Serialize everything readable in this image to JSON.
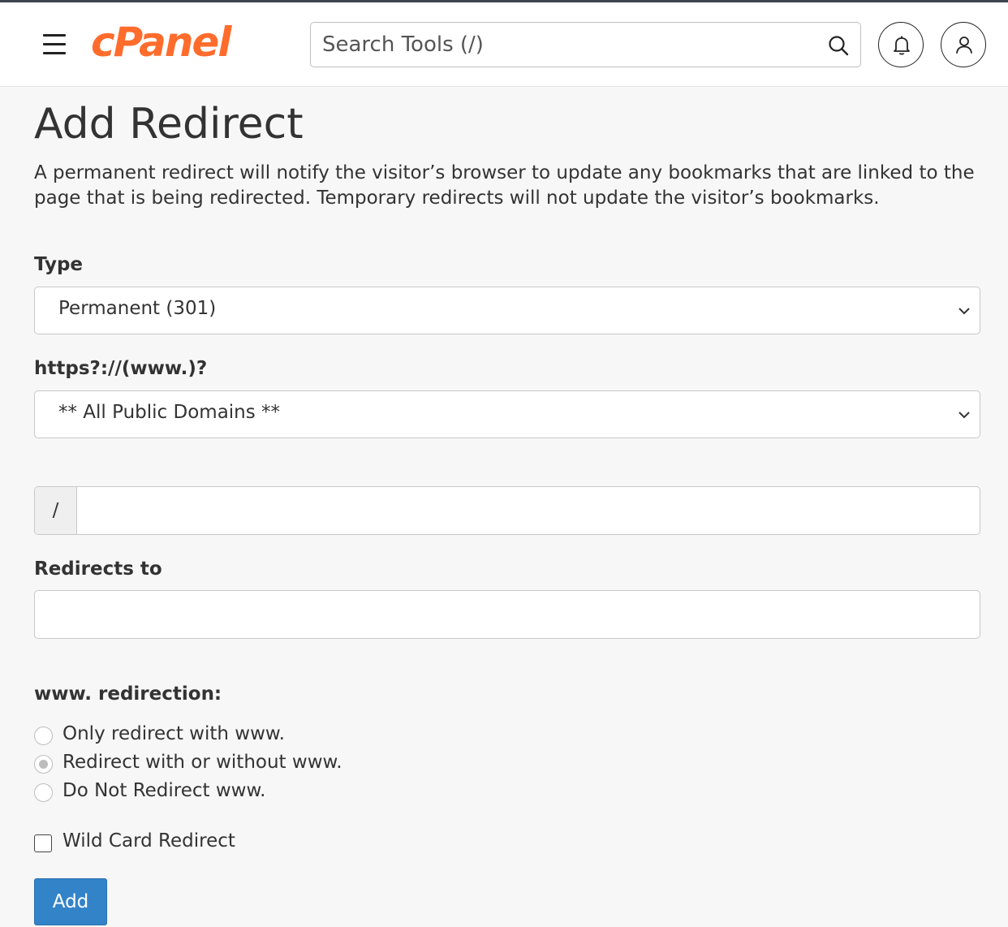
{
  "header": {
    "logo_text": "cPanel",
    "brand_color": "#ff6c2c",
    "search_placeholder": "Search Tools (/)",
    "icons": [
      "menu-icon",
      "search-icon",
      "bell-icon",
      "user-icon"
    ]
  },
  "page": {
    "title": "Add Redirect",
    "description": "A permanent redirect will notify the visitor’s browser to update any bookmarks that are linked to the page that is being redirected. Temporary redirects will not update the visitor’s bookmarks."
  },
  "form": {
    "type_label": "Type",
    "type_value": "Permanent (301)",
    "domain_label": "https?://(www.)?",
    "domain_value": "** All Public Domains **",
    "path_prefix": "/",
    "path_value": "",
    "redirects_to_label": "Redirects to",
    "redirects_to_value": "",
    "www_label": "www. redirection:",
    "www_options": [
      {
        "label": "Only redirect with www.",
        "checked": false
      },
      {
        "label": "Redirect with or without www.",
        "checked": true
      },
      {
        "label": "Do Not Redirect www.",
        "checked": false
      }
    ],
    "wildcard_label": "Wild Card Redirect",
    "wildcard_checked": false,
    "submit_label": "Add",
    "accent_color": "#3383c9"
  }
}
